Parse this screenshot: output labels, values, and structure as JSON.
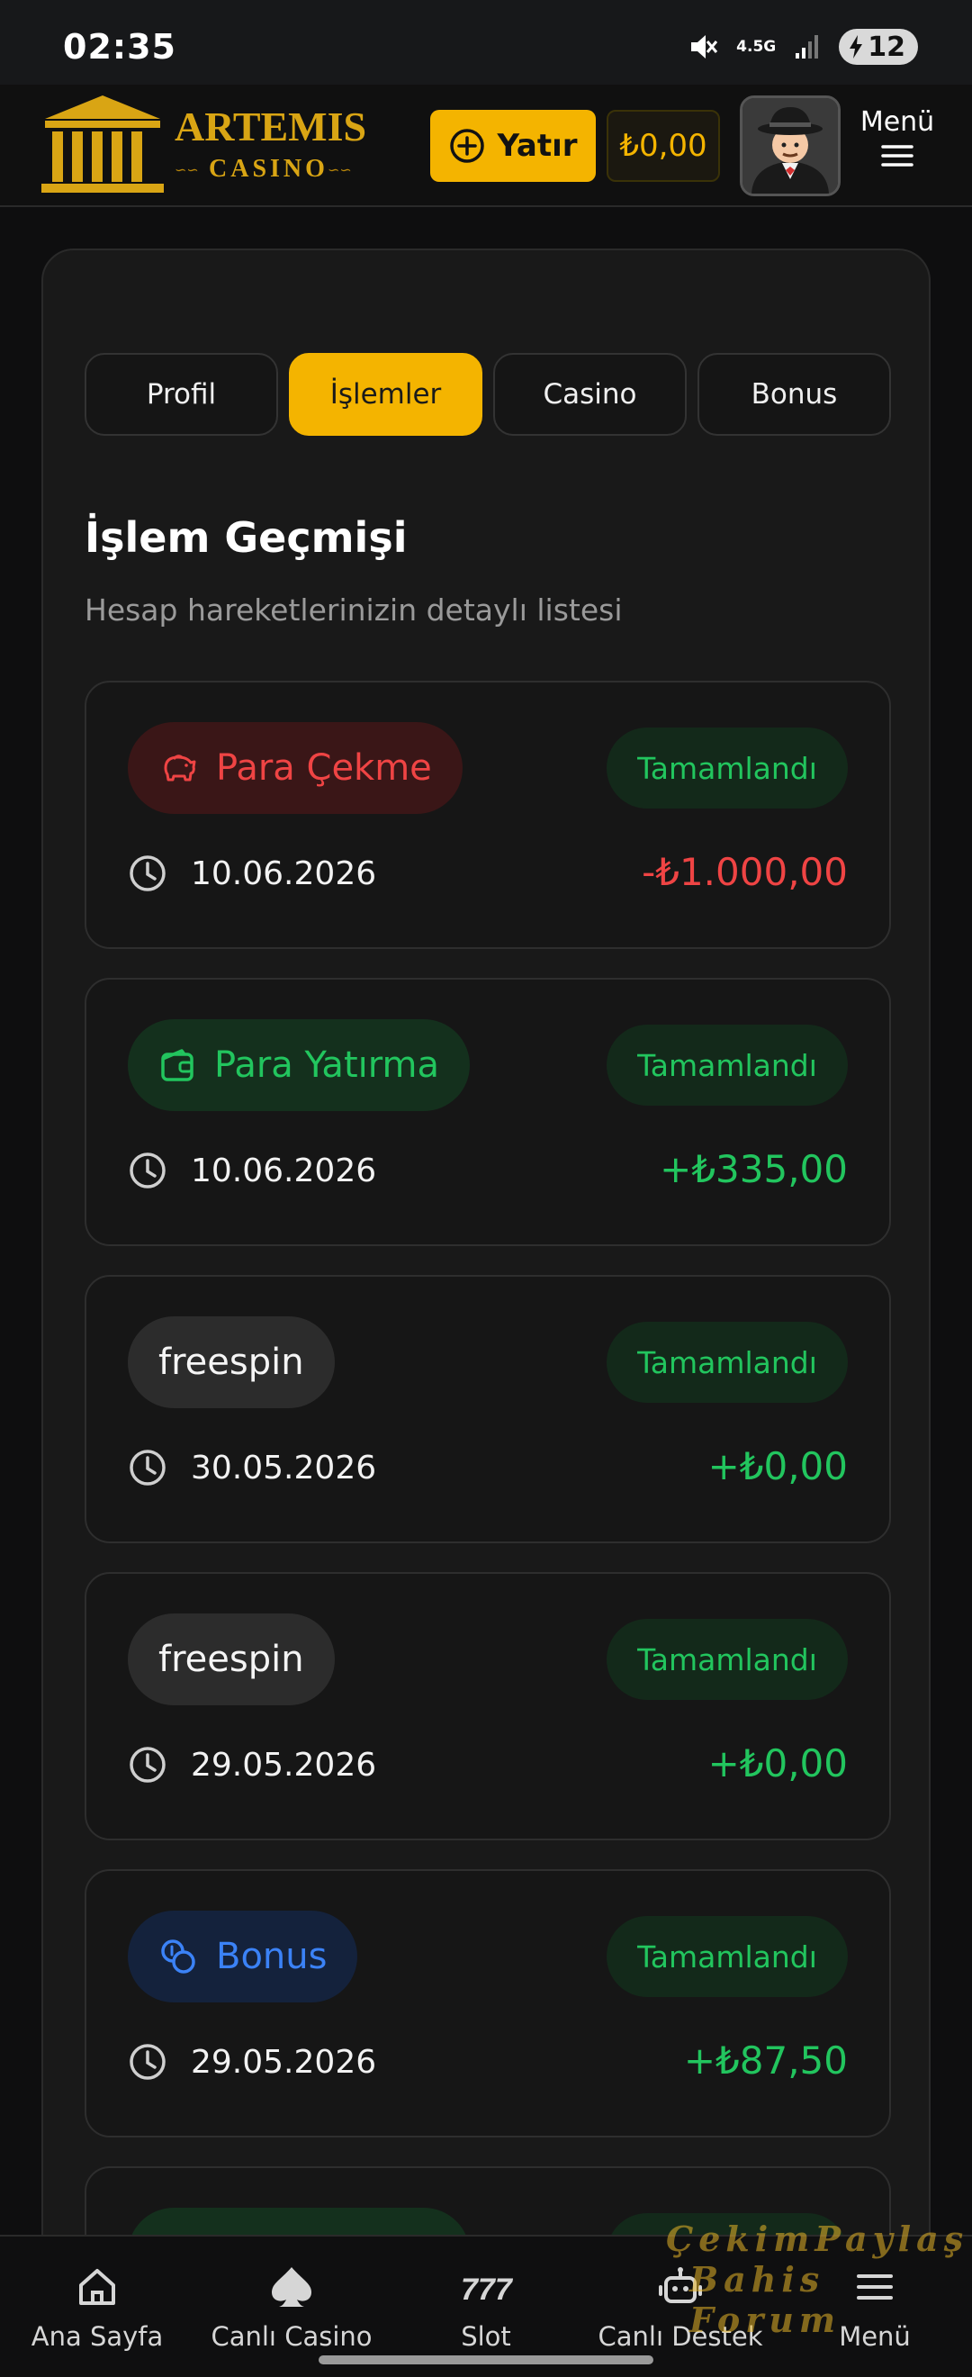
{
  "status_bar": {
    "time": "02:35",
    "network": "4.5G",
    "battery": "12"
  },
  "header": {
    "logo_title": "ARTEMIS",
    "logo_subtitle": "CASINO",
    "deposit_label": "Yatır",
    "balance": "₺0,00",
    "menu_label": "Menü",
    "brand_color": "#f4b400"
  },
  "tabs": [
    {
      "label": "Profil",
      "active": false
    },
    {
      "label": "İşlemler",
      "active": true
    },
    {
      "label": "Casino",
      "active": false
    },
    {
      "label": "Bonus",
      "active": false
    }
  ],
  "history": {
    "title": "İşlem Geçmişi",
    "subtitle": "Hesap hareketlerinizin detaylı listesi",
    "transactions": [
      {
        "type": "Para Çekme",
        "icon": "piggy-bank-icon",
        "status": "Tamamlandı",
        "date": "10.06.2026",
        "amount": "-₺1.000,00"
      },
      {
        "type": "Para Yatırma",
        "icon": "wallet-icon",
        "status": "Tamamlandı",
        "date": "10.06.2026",
        "amount": "+₺335,00"
      },
      {
        "type": "freespin",
        "icon": "",
        "status": "Tamamlandı",
        "date": "30.05.2026",
        "amount": "+₺0,00"
      },
      {
        "type": "freespin",
        "icon": "",
        "status": "Tamamlandı",
        "date": "29.05.2026",
        "amount": "+₺0,00"
      },
      {
        "type": "Bonus",
        "icon": "coins-icon",
        "status": "Tamamlandı",
        "date": "29.05.2026",
        "amount": "+₺87,50"
      }
    ]
  },
  "bottom_nav": [
    {
      "label": "Ana Sayfa",
      "icon": "home-icon"
    },
    {
      "label": "Canlı Casino",
      "icon": "spade-icon"
    },
    {
      "label": "Slot",
      "icon": "slot-777-icon"
    },
    {
      "label": "Canlı Destek",
      "icon": "support-robot-icon"
    },
    {
      "label": "Menü",
      "icon": "hamburger-icon"
    }
  ],
  "watermark": {
    "line1": "ÇekimPaylaş",
    "line2": "Bahis Forum"
  }
}
